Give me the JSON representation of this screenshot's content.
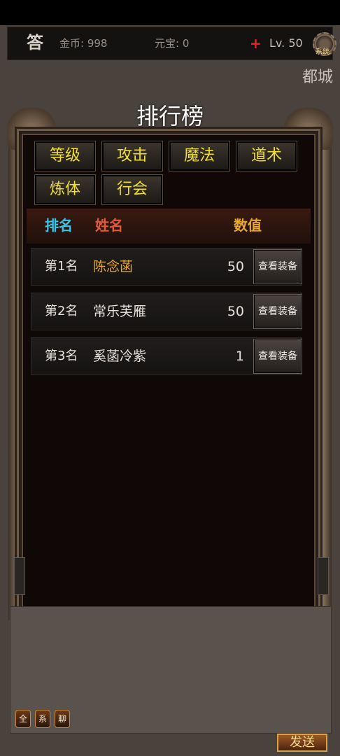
{
  "statusbar": {
    "sign_icon": "答",
    "gold": "金币: 998",
    "yuanbao": "元宝: 0",
    "plus": "+",
    "level": "Lv. 50",
    "gear_label": "系统"
  },
  "location": "都城",
  "ranking": {
    "title": "排行榜",
    "tabs": [
      "等级",
      "攻击",
      "魔法",
      "道术",
      "炼体",
      "行会"
    ],
    "headers": {
      "rank": "排名",
      "name": "姓名",
      "value": "数值"
    },
    "rows": [
      {
        "rank": "第1名",
        "name": "陈念菡",
        "value": "50",
        "button": "查看装备"
      },
      {
        "rank": "第2名",
        "name": "常乐芙雁",
        "value": "50",
        "button": "查看装备"
      },
      {
        "rank": "第3名",
        "name": "奚菡冷紫",
        "value": "1",
        "button": "查看装备"
      }
    ]
  },
  "chat": {
    "buttons": [
      "全",
      "系",
      "聊"
    ],
    "send": "发送"
  },
  "colors": {
    "tab_text": "#f0df2e",
    "rank_header": "#38c6e8",
    "name_header": "#e05a3a",
    "value_header": "#e6a72c"
  }
}
